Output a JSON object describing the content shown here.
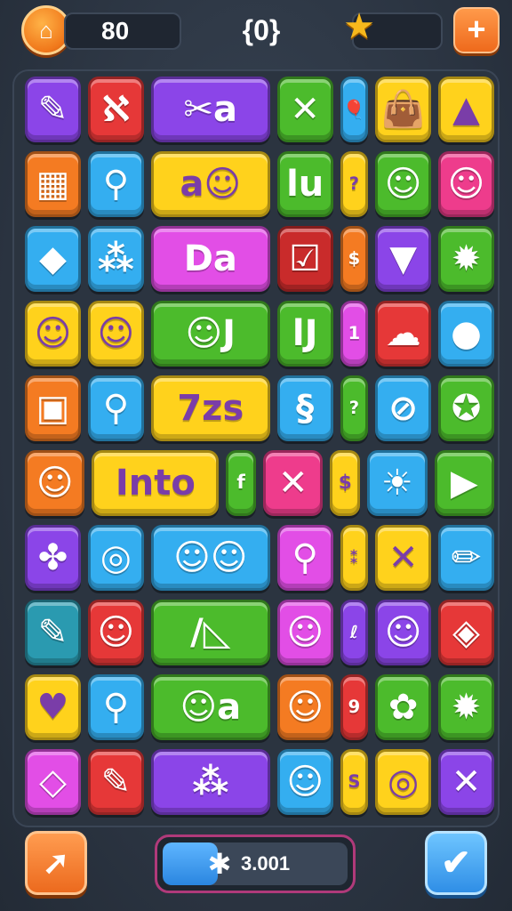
{
  "hud": {
    "home_icon": "home-icon",
    "score": "80",
    "counter": "{0}",
    "star_icon": "star-icon",
    "plus_label": "+"
  },
  "palette": {
    "purple": "#8b45e8",
    "red": "#e63838",
    "green": "#4cbb2c",
    "blue": "#34aef0",
    "yellow": "#ffd21c",
    "orange": "#f47b22",
    "pink": "#ee3c8c",
    "magenta": "#e24ee6",
    "teal": "#2a9ab0",
    "darkred": "#c92b2b"
  },
  "grid": {
    "rows": [
      [
        {
          "color": "purple",
          "w": 1,
          "glyph": "✎",
          "icon": "brush-icon"
        },
        {
          "color": "red",
          "w": 1,
          "glyph": "ℵ",
          "icon": "squiggle-icon"
        },
        {
          "color": "purple",
          "w": 2,
          "glyph": "✂a",
          "icon": "scissors-icon"
        },
        {
          "color": "green",
          "w": 1,
          "glyph": "✕",
          "icon": "crossed-tools-icon"
        },
        {
          "color": "blue",
          "w": 0.5,
          "glyph": "🎈",
          "icon": "balloon-icon"
        },
        {
          "color": "yellow",
          "w": 1,
          "glyph": "👜",
          "icon": "bag-icon"
        },
        {
          "color": "yellow",
          "w": 1,
          "glyph": "▲",
          "icon": "triangle-icon"
        }
      ],
      [
        {
          "color": "orange",
          "w": 1,
          "glyph": "▦",
          "icon": "box-icon"
        },
        {
          "color": "blue",
          "w": 1,
          "glyph": "⚲",
          "icon": "magnifier-icon"
        },
        {
          "color": "yellow",
          "w": 2,
          "glyph": "a☺",
          "icon": "letter-face-icon"
        },
        {
          "color": "green",
          "w": 1,
          "glyph": "lu",
          "icon": "letters-icon"
        },
        {
          "color": "yellow",
          "w": 0.5,
          "glyph": "?",
          "icon": "hook-icon"
        },
        {
          "color": "green",
          "w": 1,
          "glyph": "☺",
          "icon": "blob-face-icon"
        },
        {
          "color": "pink",
          "w": 1,
          "glyph": "☺",
          "icon": "monster-face-icon"
        }
      ],
      [
        {
          "color": "blue",
          "w": 1,
          "glyph": "◆",
          "icon": "popsicle-icon"
        },
        {
          "color": "blue",
          "w": 1,
          "glyph": "⁂",
          "icon": "dots-icon"
        },
        {
          "color": "magenta",
          "w": 2,
          "glyph": "Da",
          "icon": "letters-block-icon"
        },
        {
          "color": "darkred",
          "w": 1,
          "glyph": "☑",
          "icon": "checkbox-icon"
        },
        {
          "color": "orange",
          "w": 0.5,
          "glyph": "$",
          "icon": "dollar-icon"
        },
        {
          "color": "purple",
          "w": 1,
          "glyph": "▼",
          "icon": "ice-cream-icon"
        },
        {
          "color": "green",
          "w": 1,
          "glyph": "✹",
          "icon": "sun-icon"
        }
      ],
      [
        {
          "color": "yellow",
          "w": 1,
          "glyph": "☺",
          "icon": "cat-face-icon"
        },
        {
          "color": "yellow",
          "w": 1,
          "glyph": "☺",
          "icon": "speech-face-icon"
        },
        {
          "color": "green",
          "w": 2,
          "glyph": "☺J",
          "icon": "fish-letter-icon"
        },
        {
          "color": "green",
          "w": 1,
          "glyph": "lJ",
          "icon": "letters-icon"
        },
        {
          "color": "magenta",
          "w": 0.5,
          "glyph": "1",
          "icon": "number-icon"
        },
        {
          "color": "red",
          "w": 1,
          "glyph": "☁",
          "icon": "chat-bubble-icon"
        },
        {
          "color": "blue",
          "w": 1,
          "glyph": "●",
          "icon": "lollipop-icon"
        }
      ],
      [
        {
          "color": "orange",
          "w": 1,
          "glyph": "▣",
          "icon": "robot-icon"
        },
        {
          "color": "blue",
          "w": 1,
          "glyph": "⚲",
          "icon": "magnifier-icon"
        },
        {
          "color": "yellow",
          "w": 2,
          "glyph": "7zs",
          "icon": "text-tile-icon"
        },
        {
          "color": "blue",
          "w": 1,
          "glyph": "§",
          "icon": "symbol-card-icon"
        },
        {
          "color": "green",
          "w": 0.5,
          "glyph": "?",
          "icon": "hook-icon"
        },
        {
          "color": "blue",
          "w": 1,
          "glyph": "⊘",
          "icon": "no-sign-icon"
        },
        {
          "color": "green",
          "w": 1,
          "glyph": "✪",
          "icon": "gear-ring-icon"
        }
      ],
      [
        {
          "color": "orange",
          "w": 1,
          "glyph": "☺",
          "icon": "cat-face-icon"
        },
        {
          "color": "yellow",
          "w": 2,
          "glyph": "Into",
          "icon": "word-tile-icon"
        },
        {
          "color": "green",
          "w": 0.5,
          "glyph": "f",
          "icon": "letter-f-icon"
        },
        {
          "color": "pink",
          "w": 1,
          "glyph": "✕",
          "icon": "cross-icon"
        },
        {
          "color": "yellow",
          "w": 0.5,
          "glyph": "$",
          "icon": "dollar-icon"
        },
        {
          "color": "blue",
          "w": 1,
          "glyph": "☀",
          "icon": "sun-icon"
        },
        {
          "color": "green",
          "w": 1,
          "glyph": "▶",
          "icon": "pencil-tip-icon"
        }
      ],
      [
        {
          "color": "purple",
          "w": 1,
          "glyph": "✤",
          "icon": "flower-icon"
        },
        {
          "color": "blue",
          "w": 1,
          "glyph": "◎",
          "icon": "spiral-icon"
        },
        {
          "color": "blue",
          "w": 2,
          "glyph": "☺☺",
          "icon": "twin-faces-icon"
        },
        {
          "color": "magenta",
          "w": 1,
          "glyph": "⚲",
          "icon": "paddle-icon"
        },
        {
          "color": "yellow",
          "w": 0.5,
          "glyph": "⁑",
          "icon": "confetti-icon"
        },
        {
          "color": "yellow",
          "w": 1,
          "glyph": "✕",
          "icon": "cross-icon"
        },
        {
          "color": "blue",
          "w": 1,
          "glyph": "✏",
          "icon": "pencil-icon"
        }
      ],
      [
        {
          "color": "teal",
          "w": 1,
          "glyph": "✎",
          "icon": "brush-icon"
        },
        {
          "color": "red",
          "w": 1,
          "glyph": "☺",
          "icon": "cat-face-icon"
        },
        {
          "color": "green",
          "w": 2,
          "glyph": "/◺",
          "icon": "ruler-icon"
        },
        {
          "color": "magenta",
          "w": 1,
          "glyph": "☺",
          "icon": "bug-face-icon"
        },
        {
          "color": "purple",
          "w": 0.5,
          "glyph": "ℓ",
          "icon": "squiggle-icon"
        },
        {
          "color": "purple",
          "w": 1,
          "glyph": "☺",
          "icon": "block-face-icon"
        },
        {
          "color": "red",
          "w": 1,
          "glyph": "◈",
          "icon": "rocket-icon"
        }
      ],
      [
        {
          "color": "yellow",
          "w": 1,
          "glyph": "♥",
          "icon": "heart-ring-icon"
        },
        {
          "color": "blue",
          "w": 1,
          "glyph": "⚲",
          "icon": "magnifier-icon"
        },
        {
          "color": "green",
          "w": 2,
          "glyph": "☺a",
          "icon": "fruit-letter-icon"
        },
        {
          "color": "orange",
          "w": 1,
          "glyph": "☺",
          "icon": "alien-face-icon"
        },
        {
          "color": "red",
          "w": 0.5,
          "glyph": "9",
          "icon": "number-icon"
        },
        {
          "color": "green",
          "w": 1,
          "glyph": "✿",
          "icon": "leaf-icon"
        },
        {
          "color": "green",
          "w": 1,
          "glyph": "✹",
          "icon": "sun-icon"
        }
      ],
      [
        {
          "color": "magenta",
          "w": 1,
          "glyph": "◇",
          "icon": "kite-icon"
        },
        {
          "color": "red",
          "w": 1,
          "glyph": "✎",
          "icon": "dropper-icon"
        },
        {
          "color": "purple",
          "w": 2,
          "glyph": "⁂",
          "icon": "dots-icon"
        },
        {
          "color": "blue",
          "w": 1,
          "glyph": "☺",
          "icon": "creature-icon"
        },
        {
          "color": "yellow",
          "w": 0.5,
          "glyph": "S",
          "icon": "letter-s-icon"
        },
        {
          "color": "yellow",
          "w": 1,
          "glyph": "◎",
          "icon": "target-icon"
        },
        {
          "color": "purple",
          "w": 1,
          "glyph": "✕",
          "icon": "cross-icon"
        }
      ]
    ]
  },
  "footer": {
    "back_icon": "arrow-icon",
    "progress_value": 0.3,
    "progress_label": "3.001",
    "gear_icon": "gear-icon",
    "confirm_icon": "check-icon"
  }
}
